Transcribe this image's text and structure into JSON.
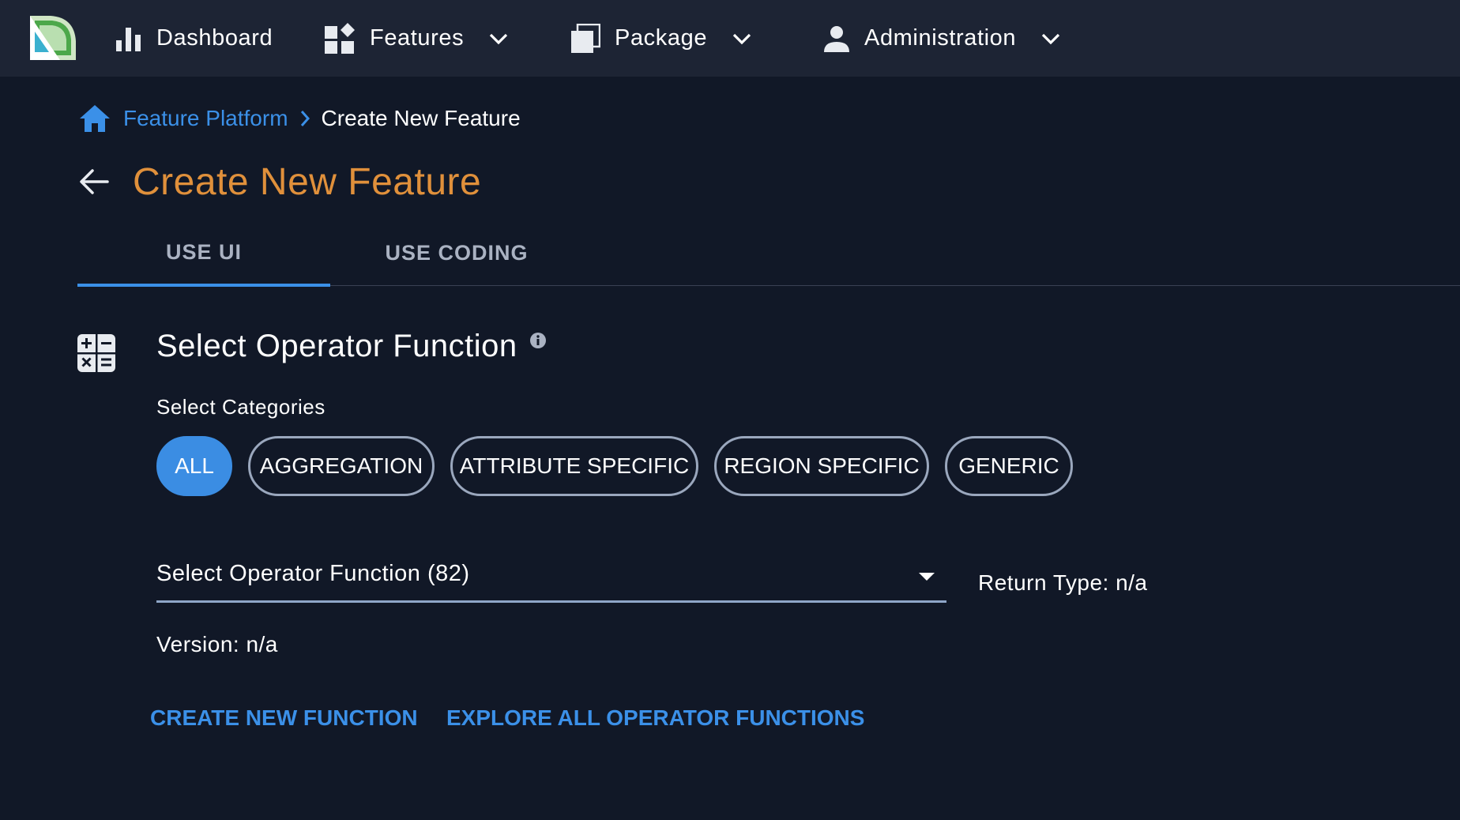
{
  "colors": {
    "background": "#111827",
    "topbar": "#1d2434",
    "accent_blue": "#3b90e8",
    "title_orange": "#e0903b",
    "chip_border": "#9aa7bd"
  },
  "nav": {
    "logo_icon": "app-logo-icon",
    "items": [
      {
        "label": "Dashboard",
        "icon": "bar-chart-icon",
        "has_dropdown": false
      },
      {
        "label": "Features",
        "icon": "features-widgets-icon",
        "has_dropdown": true
      },
      {
        "label": "Package",
        "icon": "package-stack-icon",
        "has_dropdown": true
      },
      {
        "label": "Administration",
        "icon": "person-icon",
        "has_dropdown": true
      }
    ]
  },
  "breadcrumb": {
    "home_icon": "home-icon",
    "link": "Feature Platform",
    "separator_icon": "chevron-right-icon",
    "current": "Create New Feature"
  },
  "page": {
    "back_icon": "arrow-left-icon",
    "title": "Create New Feature"
  },
  "tabs": [
    {
      "label": "USE UI",
      "active": true
    },
    {
      "label": "USE CODING",
      "active": false
    }
  ],
  "section": {
    "icon": "calculator-icon",
    "title": "Select Operator Function",
    "info_icon": "info-icon",
    "categories_label": "Select Categories",
    "categories": [
      {
        "label": "ALL",
        "selected": true
      },
      {
        "label": "AGGREGATION",
        "selected": false
      },
      {
        "label": "ATTRIBUTE SPECIFIC",
        "selected": false
      },
      {
        "label": "REGION SPECIFIC",
        "selected": false
      },
      {
        "label": "GENERIC",
        "selected": false
      }
    ],
    "select": {
      "value": "Select Operator Function (82)",
      "caret_icon": "caret-down-icon"
    },
    "return_type": "Return Type: n/a",
    "version": "Version: n/a",
    "actions": {
      "create": "CREATE NEW FUNCTION",
      "explore": "EXPLORE ALL OPERATOR FUNCTIONS"
    }
  }
}
